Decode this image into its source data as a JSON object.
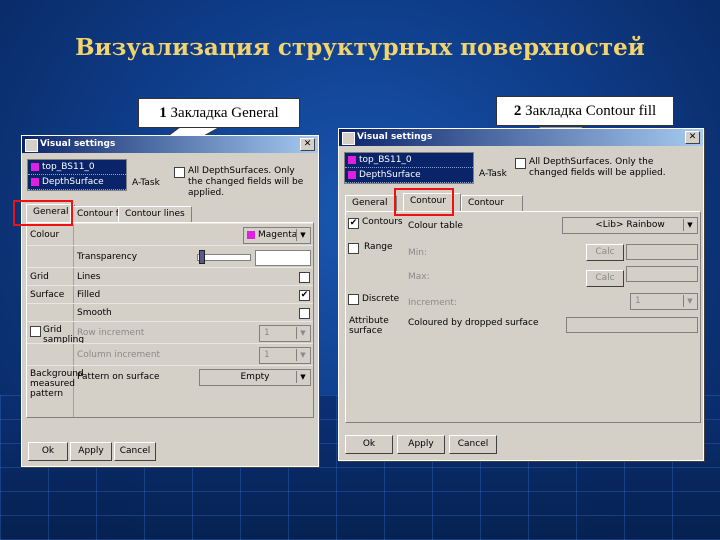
{
  "slide": {
    "title": "Визуализация структурных поверхностей"
  },
  "callouts": {
    "left": {
      "number": "1",
      "text": "Закладка General"
    },
    "right": {
      "number": "2",
      "text": "Закладка Contour fill"
    }
  },
  "win1": {
    "title": "Visual settings",
    "surfaces": [
      "top_BS11_0",
      "DepthSurface"
    ],
    "all_label": "All DepthSurfaces. Only the changed fields will be applied.",
    "task_label": "A-Task",
    "tabs": [
      "General",
      "Contour fill",
      "Contour lines"
    ],
    "rows": {
      "colour": "Colour",
      "colour_value": "Magenta",
      "transparency": "Transparency",
      "grid": "Grid",
      "lines": "Lines",
      "surface": "Surface",
      "filled": "Filled",
      "smooth": "Smooth",
      "grid_sampling": "Grid sampling",
      "row_increment": "Row increment",
      "row_value": "1",
      "col_increment": "Column increment",
      "col_value": "1",
      "background": "Background measured pattern",
      "pattern_label": "Pattern on surface",
      "pattern_value": "Empty"
    },
    "buttons": {
      "ok": "Ok",
      "apply": "Apply",
      "cancel": "Cancel"
    }
  },
  "win2": {
    "title": "Visual settings",
    "surfaces": [
      "top_BS11_0",
      "DepthSurface"
    ],
    "all_label": "All DepthSurfaces. Only the changed fields will be applied.",
    "task_label": "A-Task",
    "tabs": [
      "General",
      "Contour fill",
      "Contour lines"
    ],
    "rows": {
      "contours": "Contours",
      "colour_table": "Colour table",
      "colour_table_value": "<Lib> Rainbow",
      "range": "Range",
      "min": "Min:",
      "max": "Max:",
      "calc": "Calc",
      "discrete": "Discrete",
      "increment": "Increment:",
      "increment_value": "1",
      "attribute_surface": "Attribute surface",
      "coloured_by": "Coloured by dropped surface"
    },
    "buttons": {
      "ok": "Ok",
      "apply": "Apply",
      "cancel": "Cancel"
    }
  },
  "colors": {
    "title": "#f3d36b",
    "highlight": "#ee1111",
    "swatch": "#e020e0"
  }
}
